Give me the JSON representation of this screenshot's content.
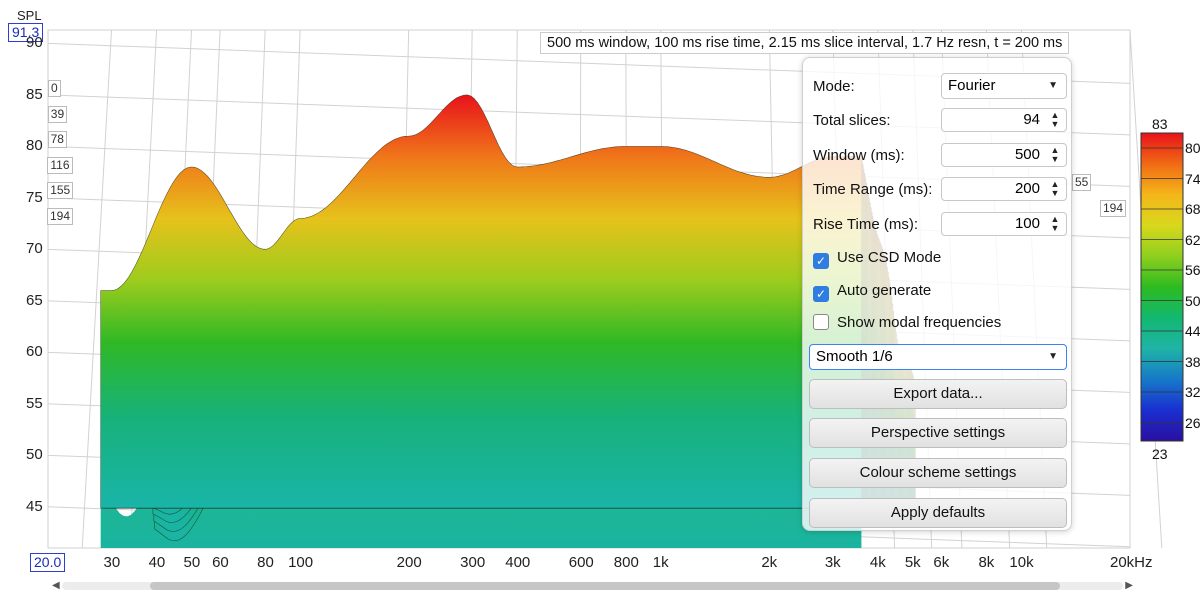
{
  "info_banner": "500 ms window, 100 ms rise time, 2.15 ms slice interval, 1.7 Hz resn, t = 200 ms",
  "y_axis": {
    "title": "SPL",
    "top_value": "91.3",
    "ticks": [
      "90",
      "85",
      "80",
      "75",
      "70",
      "65",
      "60",
      "55",
      "50",
      "45"
    ]
  },
  "x_axis": {
    "left_value": "20.0",
    "ticks": [
      "30",
      "40",
      "50",
      "60",
      "80",
      "100",
      "200",
      "300",
      "400",
      "600",
      "800",
      "1k",
      "2k",
      "3k",
      "4k",
      "5k",
      "6k",
      "8k",
      "10k",
      "20kHz"
    ]
  },
  "slice_times_left": [
    "0",
    "39",
    "78",
    "116",
    "155",
    "194"
  ],
  "slice_times_right": [
    "55",
    "194"
  ],
  "panel": {
    "mode_label": "Mode:",
    "mode_value": "Fourier",
    "total_slices_label": "Total slices:",
    "total_slices_value": "94",
    "window_label": "Window (ms):",
    "window_value": "500",
    "time_range_label": "Time Range (ms):",
    "time_range_value": "200",
    "rise_time_label": "Rise Time (ms):",
    "rise_time_value": "100",
    "use_csd_label": "Use CSD Mode",
    "use_csd_checked": true,
    "auto_generate_label": "Auto generate",
    "auto_generate_checked": true,
    "show_modal_label": "Show modal frequencies",
    "show_modal_checked": false,
    "smoothing_value": "Smooth 1/6",
    "export_button": "Export data...",
    "perspective_button": "Perspective settings",
    "colour_button": "Colour scheme settings",
    "apply_button": "Apply defaults"
  },
  "color_legend": {
    "max": "83",
    "min": "23",
    "ticks": [
      "80",
      "74",
      "68",
      "62",
      "56",
      "50",
      "44",
      "38",
      "32",
      "26"
    ],
    "colors": [
      "#e8121b",
      "#f06a14",
      "#f4b61a",
      "#d8d81c",
      "#8fcf1e",
      "#2dbb20",
      "#12b870",
      "#1fb4a6",
      "#1679c8",
      "#1a2fd0",
      "#2a0fa0"
    ]
  },
  "chart_data": {
    "type": "area",
    "title": "",
    "xlabel": "",
    "ylabel": "SPL",
    "x_scale": "log",
    "xlim": [
      20,
      20000
    ],
    "ylim": [
      41,
      91.3
    ],
    "peak_points_first_slice": [
      {
        "x": 30,
        "y": 66
      },
      {
        "x": 50,
        "y": 78
      },
      {
        "x": 80,
        "y": 70
      },
      {
        "x": 100,
        "y": 73
      },
      {
        "x": 200,
        "y": 81
      },
      {
        "x": 290,
        "y": 85
      },
      {
        "x": 400,
        "y": 78
      },
      {
        "x": 800,
        "y": 80
      },
      {
        "x": 1000,
        "y": 80
      },
      {
        "x": 2000,
        "y": 77
      },
      {
        "x": 3000,
        "y": 79
      }
    ]
  }
}
